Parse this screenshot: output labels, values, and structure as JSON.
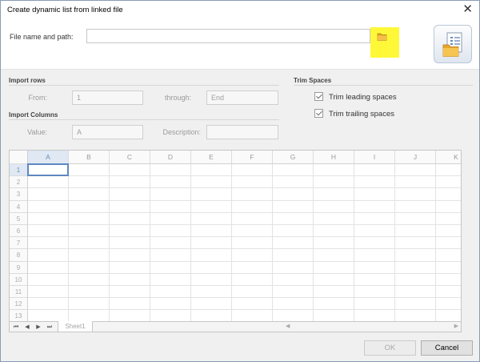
{
  "dialog": {
    "title": "Create dynamic list from linked file",
    "close_glyph": "✕"
  },
  "file": {
    "label": "File name and path:",
    "value": "",
    "browse_icon": "folder-icon",
    "list_icon": "linked-list-file-icon"
  },
  "import_rows": {
    "header": "Import rows",
    "from_label": "From:",
    "from_value": "1",
    "through_label": "through:",
    "through_value": "End"
  },
  "import_columns": {
    "header": "Import Columns",
    "value_label": "Value:",
    "value_value": "A",
    "description_label": "Description:",
    "description_value": ""
  },
  "trim_spaces": {
    "header": "Trim Spaces",
    "leading_label": "Trim leading spaces",
    "leading_checked": true,
    "trailing_label": "Trim trailing spaces",
    "trailing_checked": true
  },
  "grid": {
    "columns": [
      "A",
      "B",
      "C",
      "D",
      "E",
      "F",
      "G",
      "H",
      "I",
      "J",
      "K"
    ],
    "rows": [
      "1",
      "2",
      "3",
      "4",
      "5",
      "6",
      "7",
      "8",
      "9",
      "10",
      "11",
      "12",
      "13"
    ],
    "selected_cell": "A1"
  },
  "sheet_bar": {
    "nav_first": "⏮",
    "nav_prev": "◀",
    "nav_next": "▶",
    "nav_last": "⏭",
    "sheet_tab": "Sheet1",
    "scroll_left": "◀",
    "scroll_right": "▶"
  },
  "buttons": {
    "ok": "OK",
    "ok_enabled": false,
    "cancel": "Cancel"
  },
  "colors": {
    "browse_highlight": "#fff838",
    "selection": "#5d88c0"
  }
}
